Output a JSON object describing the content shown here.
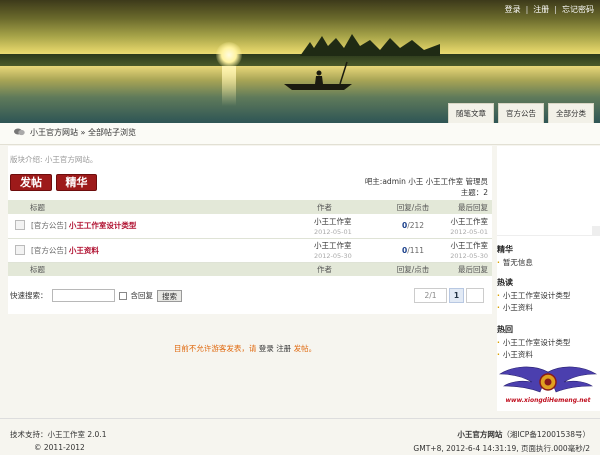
{
  "header": {
    "top_links": [
      "登录",
      "注册",
      "忘记密码"
    ],
    "nav_tabs": [
      "随笔文章",
      "官方公告",
      "全部分类"
    ]
  },
  "breadcrumb": {
    "site": "小王官方网站",
    "separator": "»",
    "current": "全部帖子浏览"
  },
  "board": {
    "description": "版块介绍: 小王官方网站。",
    "post_button": "发帖",
    "digest_button": "精华",
    "moderators": "吧主:admin 小王 小王工作室 管理员",
    "topics": "主题：2"
  },
  "table": {
    "headers": [
      "标题",
      "作者",
      "回复/点击",
      "最后回复"
    ],
    "rows": [
      {
        "category": "[官方公告]",
        "title": "小王工作室设计类型",
        "author": "小王工作室",
        "date": "2012-05-01",
        "replies": "0",
        "clicks": "/212",
        "last_user": "小王工作室",
        "last_date": "2012-05-01"
      },
      {
        "category": "[官方公告]",
        "title": "小王资料",
        "author": "小王工作室",
        "date": "2012-05-30",
        "replies": "0",
        "clicks": "/111",
        "last_user": "小王工作室",
        "last_date": "2012-05-30"
      }
    ]
  },
  "search": {
    "label": "快速搜索：",
    "value": "",
    "checkbox_label": "含回复",
    "button": "搜索"
  },
  "pager": {
    "info": "2/1",
    "current": "1"
  },
  "notice": {
    "text": "目前不允许游客发表，请",
    "login": "登录",
    "register": "注册",
    "end": "发帖。"
  },
  "sidebar": {
    "sections": [
      {
        "title": "精华",
        "items": [
          "暂无信息"
        ]
      },
      {
        "title": "热读",
        "items": [
          "小王工作室设计类型",
          "小王资料"
        ]
      },
      {
        "title": "热回",
        "items": [
          "小王工作室设计类型",
          "小王资料"
        ]
      }
    ],
    "logo_url_text": "www.xiongdiHemeng.net"
  },
  "footer": {
    "support": "技术支持：小王工作室 2.0.1",
    "copyright": "© 2011-2012",
    "site_name": "小王官方网站",
    "icp": "（湘ICP备12001538号）",
    "runtime": "GMT+8, 2012-6-4 14:31:19, 页面执行.000毫秒/2"
  },
  "colors": {
    "accent_red": "#9d1a1a",
    "title_red": "#b01030",
    "notice_orange": "#e06a10",
    "count_blue": "#1a3f8a"
  }
}
